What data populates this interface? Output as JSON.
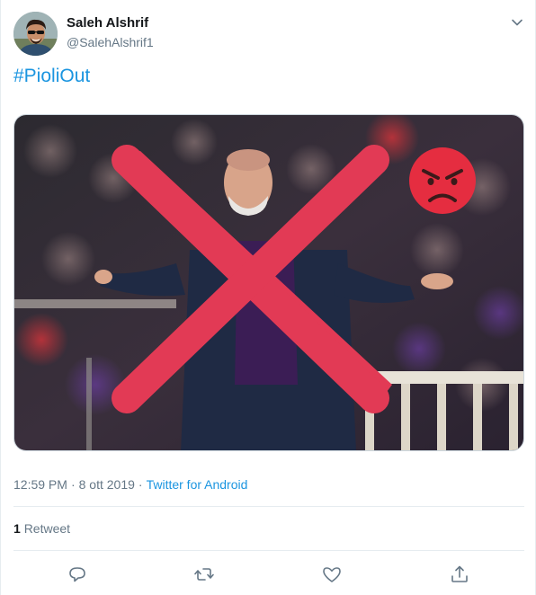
{
  "author": {
    "display_name": "Saleh Alshrif",
    "handle": "@SalehAlshrif1"
  },
  "tweet": {
    "text": "#PioliOut"
  },
  "meta": {
    "time": "12:59 PM",
    "separator": "·",
    "date": "8 ott 2019",
    "source": "Twitter for Android"
  },
  "stats": {
    "retweet_count": "1",
    "retweet_label": "Retweet"
  },
  "icons": {
    "caret": "chevron-down-icon",
    "reply": "reply-icon",
    "retweet": "retweet-icon",
    "like": "like-icon",
    "share": "share-icon",
    "emoji": "angry-face-emoji"
  },
  "colors": {
    "link": "#1b95e0",
    "secondary_text": "#657786",
    "cross": "#e23a55",
    "emoji": "#e52d40"
  }
}
